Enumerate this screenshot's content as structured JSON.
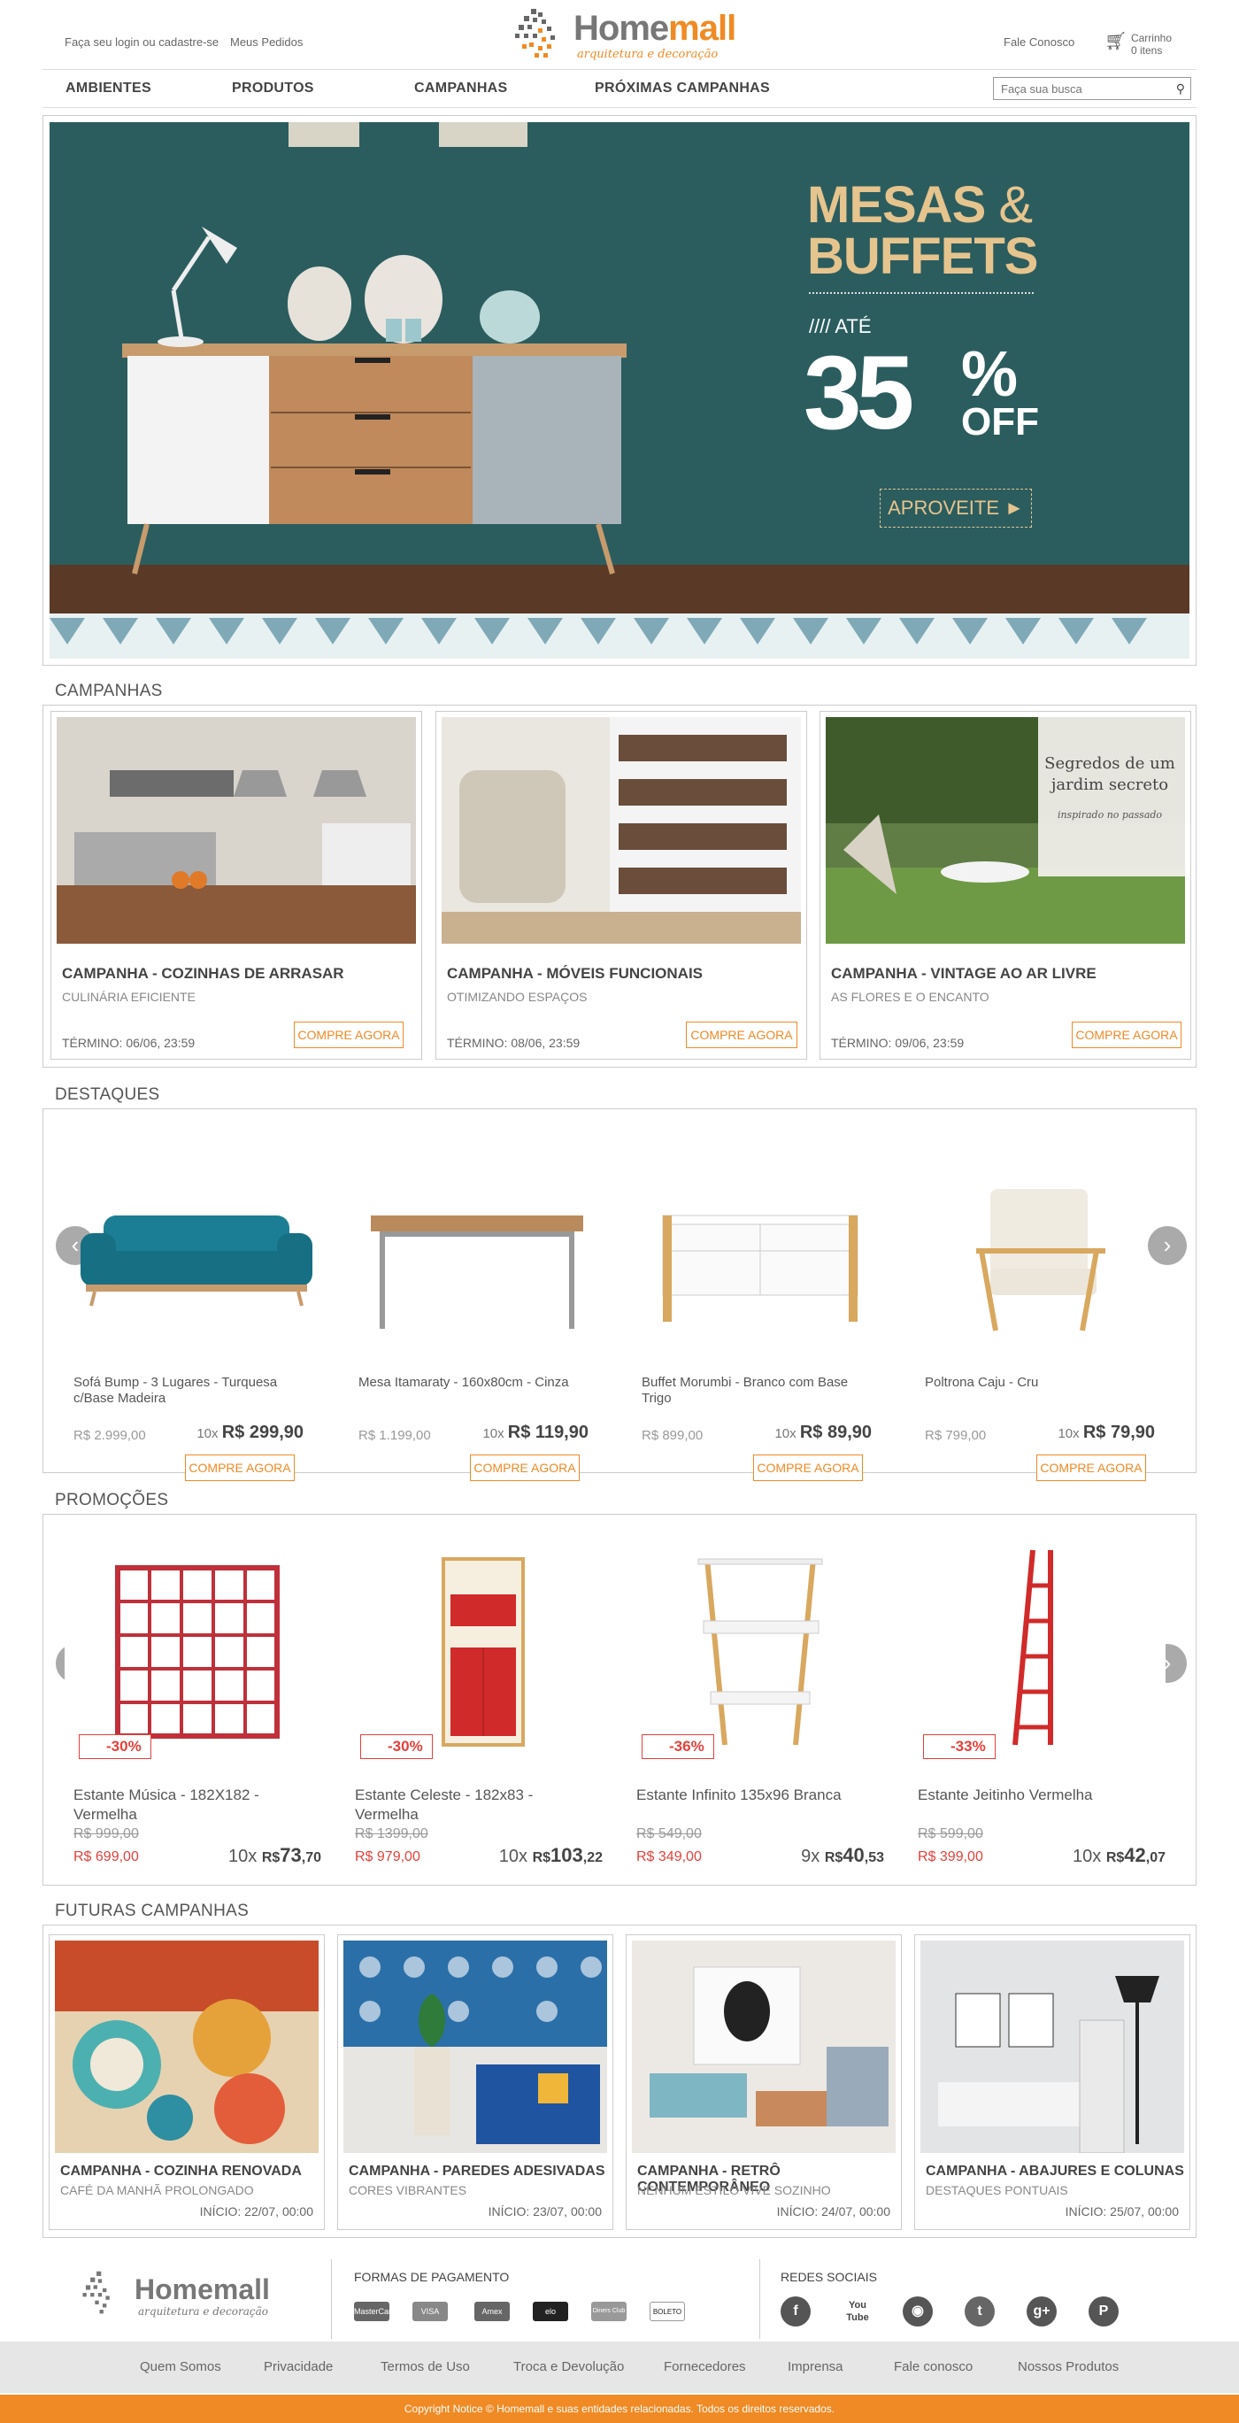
{
  "header": {
    "login": "Faça seu login ou cadastre-se",
    "orders": "Meus Pedidos",
    "logo_name_a": "Home",
    "logo_name_b": "mall",
    "logo_tagline": "arquitetura e decoração",
    "contact": "Fale Conosco",
    "cart_label": "Carrinho",
    "cart_count": "0 itens"
  },
  "nav": {
    "items": [
      "AMBIENTES",
      "PRODUTOS",
      "CAMPANHAS",
      "PRÓXIMAS CAMPANHAS"
    ],
    "search_placeholder": "Faça sua busca"
  },
  "hero": {
    "line1": "MESAS",
    "amp": "&",
    "line2": "BUFFETS",
    "until": "//// ATÉ",
    "number": "35",
    "percent": "%",
    "off": "OFF",
    "cta": "APROVEITE ►"
  },
  "campanhas": {
    "title": "CAMPANHAS",
    "items": [
      {
        "title": "CAMPANHA - COZINHAS DE ARRASAR",
        "subtitle": "CULINÁRIA EFICIENTE",
        "end": "TÉRMINO: 06/06, 23:59",
        "cta": "COMPRE AGORA"
      },
      {
        "title": "CAMPANHA - MÓVEIS FUNCIONAIS",
        "subtitle": "OTIMIZANDO ESPAÇOS",
        "end": "TÉRMINO: 08/06, 23:59",
        "cta": "COMPRE AGORA"
      },
      {
        "title": "CAMPANHA - VINTAGE AO AR LIVRE",
        "subtitle": "AS FLORES E O ENCANTO",
        "end": "TÉRMINO: 09/06, 23:59",
        "cta": "COMPRE AGORA",
        "overlay1": "Segredos de um",
        "overlay2": "jardim secreto",
        "overlay3": "inspirado no passado"
      }
    ]
  },
  "destaques": {
    "title": "DESTAQUES",
    "items": [
      {
        "name": "Sofá Bump - 3 Lugares - Turquesa c/Base Madeira",
        "old": "R$ 2.999,00",
        "inst": "10x",
        "price": "R$ 299,90",
        "cta": "COMPRE AGORA"
      },
      {
        "name": "Mesa Itamaraty - 160x80cm - Cinza",
        "old": "R$ 1.199,00",
        "inst": "10x",
        "price": "R$ 119,90",
        "cta": "COMPRE AGORA"
      },
      {
        "name": "Buffet Morumbi - Branco com Base Trigo",
        "old": "R$ 899,00",
        "inst": "10x",
        "price": "R$ 89,90",
        "cta": "COMPRE AGORA"
      },
      {
        "name": "Poltrona Caju - Cru",
        "old": "R$ 799,00",
        "inst": "10x",
        "price": "R$ 79,90",
        "cta": "COMPRE AGORA"
      }
    ]
  },
  "promocoes": {
    "title": "PROMOÇÕES",
    "items": [
      {
        "badge": "-30%",
        "name": "Estante Música - 182X182 - Vermelha",
        "old": "R$ 999,00",
        "new": "R$ 699,00",
        "inst": "10x",
        "cur": "R$",
        "int": "73",
        "dec": ",70"
      },
      {
        "badge": "-30%",
        "name": "Estante Celeste - 182x83 - Vermelha",
        "old": "R$ 1399,00",
        "new": "R$ 979,00",
        "inst": "10x",
        "cur": "R$",
        "int": "103",
        "dec": ",22"
      },
      {
        "badge": "-36%",
        "name": "Estante Infinito 135x96 Branca",
        "old": "R$ 549,00",
        "new": "R$ 349,00",
        "inst": "9x",
        "cur": "R$",
        "int": "40",
        "dec": ",53"
      },
      {
        "badge": "-33%",
        "name": "Estante Jeitinho Vermelha",
        "old": "R$ 599,00",
        "new": "R$ 399,00",
        "inst": "10x",
        "cur": "R$",
        "int": "42",
        "dec": ",07"
      }
    ]
  },
  "futuras": {
    "title": "FUTURAS CAMPANHAS",
    "items": [
      {
        "title": "CAMPANHA - COZINHA RENOVADA",
        "subtitle": "CAFÉ DA MANHÃ PROLONGADO",
        "start": "INÍCIO: 22/07, 00:00"
      },
      {
        "title": "CAMPANHA - PAREDES ADESIVADAS",
        "subtitle": "CORES VIBRANTES",
        "start": "INÍCIO: 23/07, 00:00"
      },
      {
        "title": "CAMPANHA - RETRÔ CONTEMPORÂNEO",
        "subtitle": "NENHUM ESTILO VIVE SOZINHO",
        "start": "INÍCIO: 24/07, 00:00"
      },
      {
        "title": "CAMPANHA - ABAJURES E COLUNAS",
        "subtitle": "DESTAQUES PONTUAIS",
        "start": "INÍCIO: 25/07, 00:00"
      }
    ]
  },
  "footer": {
    "payments_title": "FORMAS DE PAGAMENTO",
    "payments": [
      "MasterCard",
      "VISA",
      "Amex",
      "elo",
      "Diners Club",
      "BOLETO"
    ],
    "social_title": "REDES SOCIAIS",
    "social": [
      "f",
      "You Tube",
      "◉",
      "t",
      "g+",
      "P"
    ],
    "links": [
      "Quem Somos",
      "Privacidade",
      "Termos de Uso",
      "Troca e Devolução",
      "Fornecedores",
      "Imprensa",
      "Fale conosco",
      "Nossos Produtos"
    ],
    "copyright": "Copyright Notice © Homemall e suas entidades relacionadas. Todos os direitos reservados."
  },
  "colors": {
    "accent": "#f08a24",
    "sale": "#e5403a",
    "hero_bg": "#2a5c5e"
  }
}
